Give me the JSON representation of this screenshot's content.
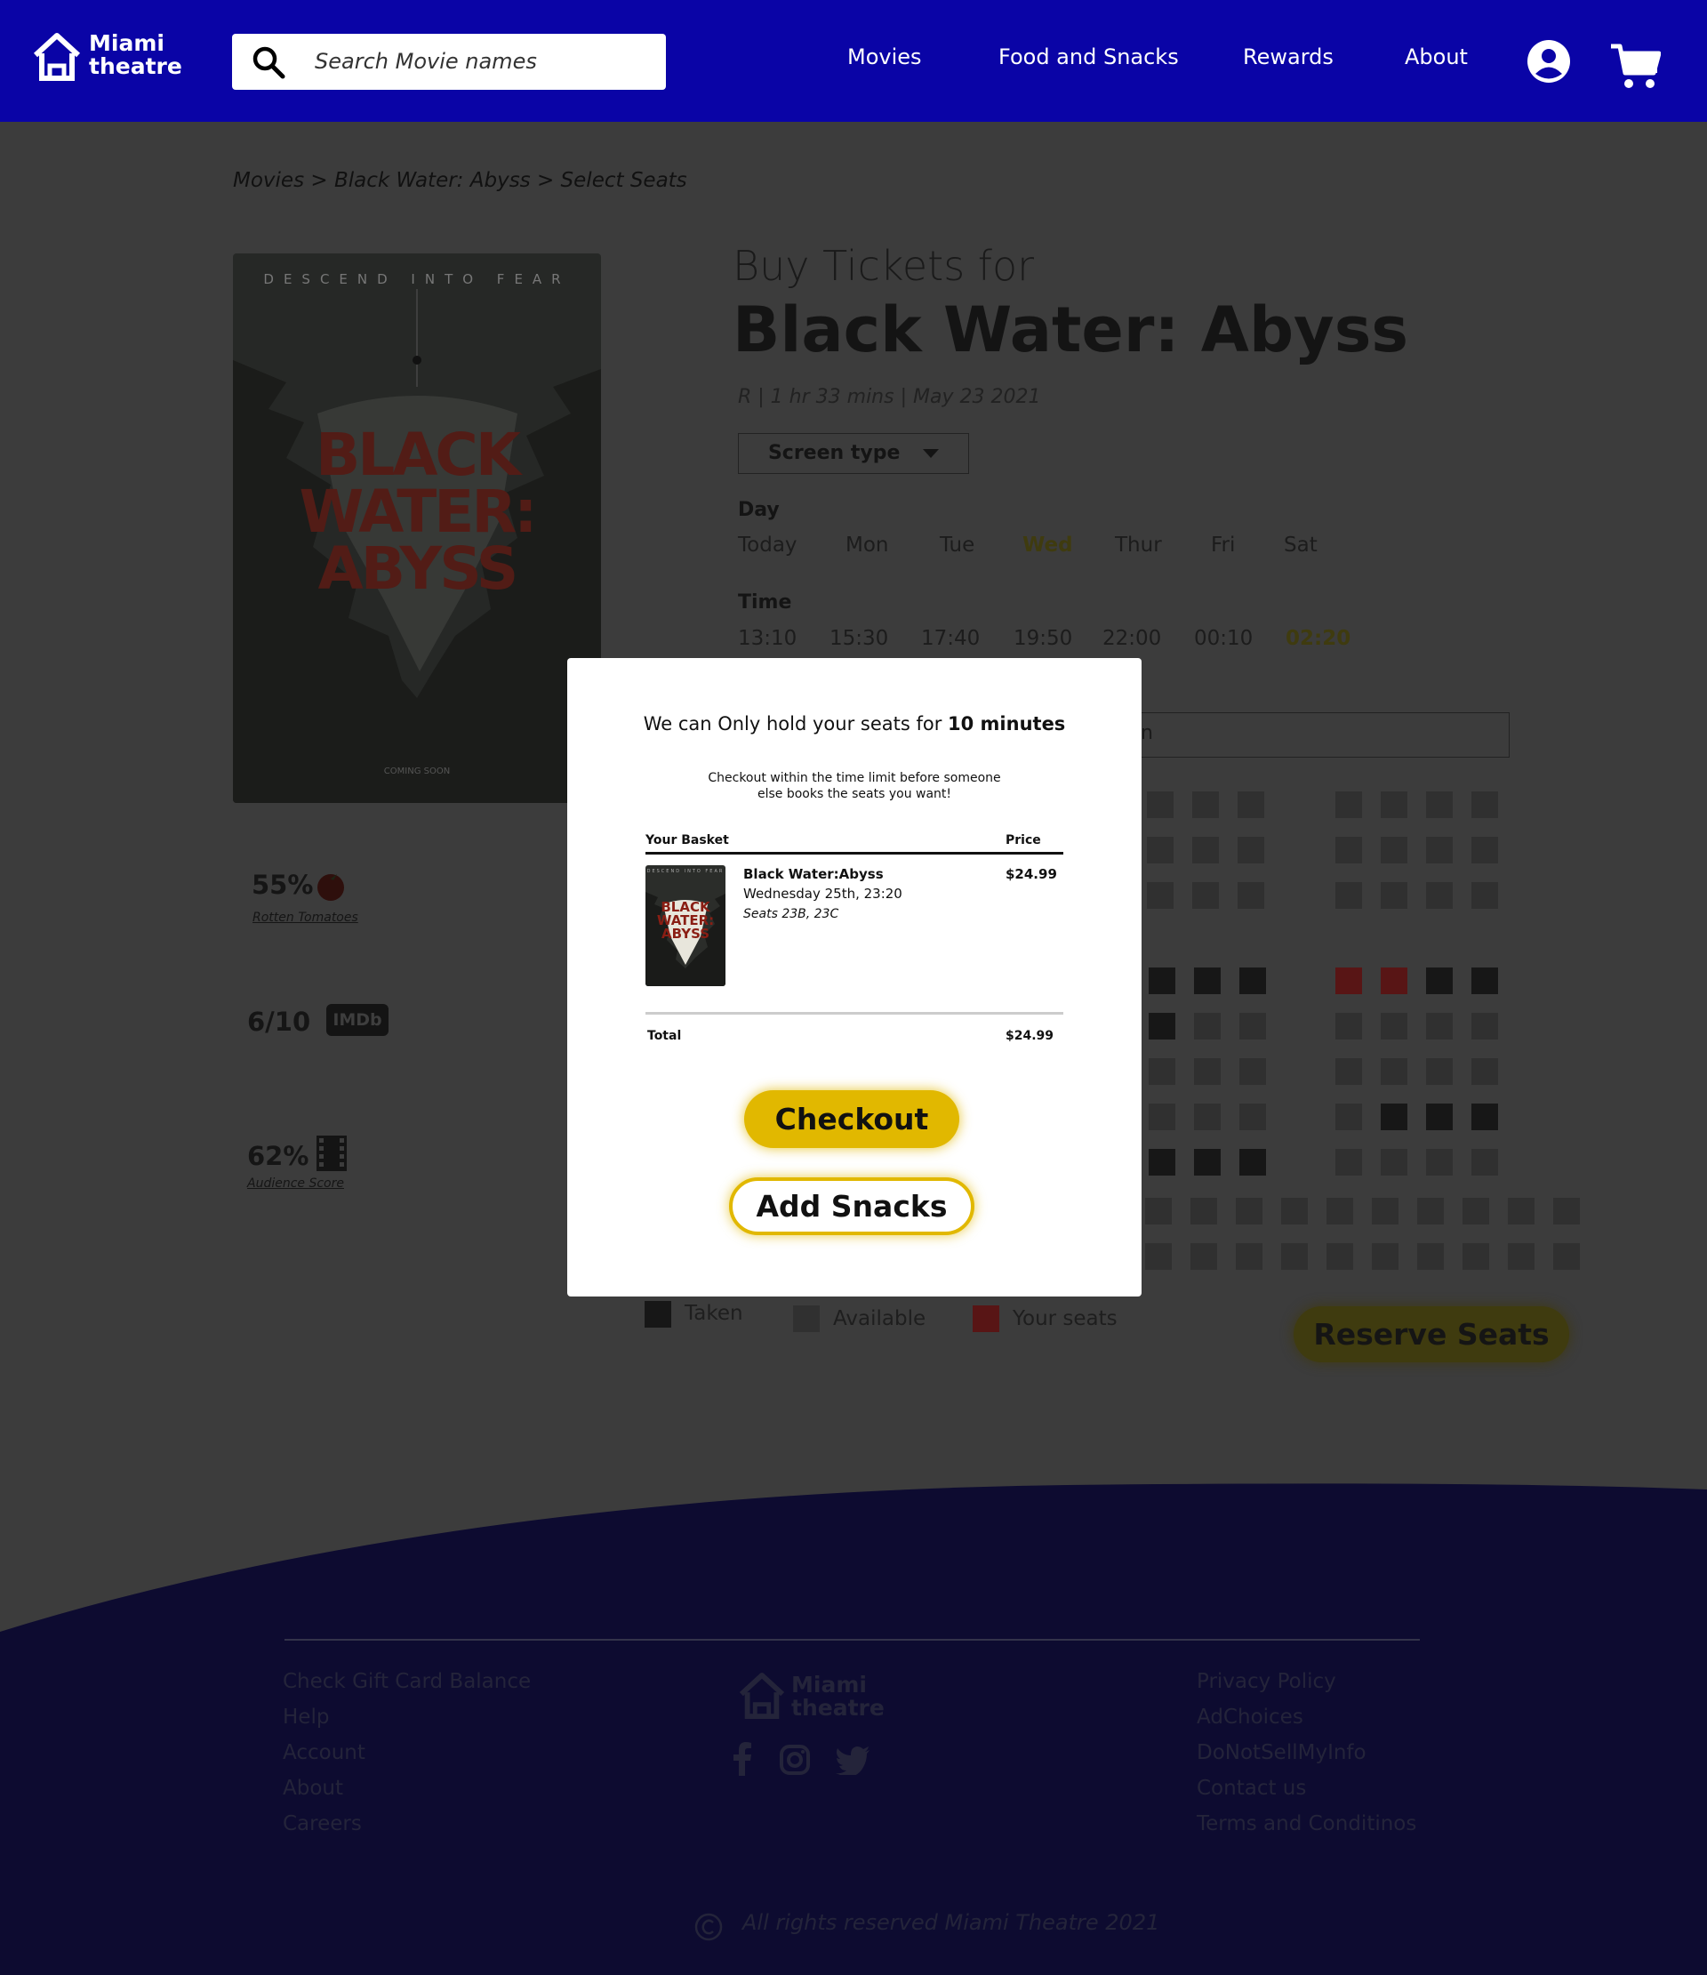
{
  "header": {
    "logo_line1": "Miami",
    "logo_line2": "theatre",
    "search_placeholder": "Search Movie names",
    "nav": [
      "Movies",
      "Food and Snacks",
      "Rewards",
      "About"
    ],
    "icons": [
      "user-icon",
      "cart-icon"
    ]
  },
  "breadcrumb": "Movies > Black Water: Abyss > Select Seats",
  "poster": {
    "tagline": "DESCEND INTO FEAR",
    "title": "BLACK WATER: ABYSS",
    "footer": "COMING SOON"
  },
  "movie": {
    "buy_label": "Buy Tickets for",
    "title": "Black Water: Abyss",
    "meta": "R | 1 hr 33 mins | May 23 2021",
    "screen_type": "Screen type"
  },
  "day": {
    "label": "Day",
    "options": [
      "Today",
      "Mon",
      "Tue",
      "Wed",
      "Thur",
      "Fri",
      "Sat"
    ],
    "selected": "Wed"
  },
  "time": {
    "label": "Time",
    "options": [
      "13:10",
      "15:30",
      "17:40",
      "19:50",
      "22:00",
      "00:10",
      "02:20"
    ],
    "selected": "02:20"
  },
  "theater_box_text": "n",
  "scores": {
    "rotten": {
      "value": "55%",
      "label": "Rotten Tomatoes"
    },
    "imdb": {
      "value": "6/10",
      "badge": "IMDb"
    },
    "audience": {
      "value": "62%",
      "label": "Audience Score"
    }
  },
  "legend": {
    "taken": "Taken",
    "available": "Available",
    "yours": "Your seats"
  },
  "reserve_label": "Reserve Seats",
  "footer": {
    "col1": [
      "Check Gift Card Balance",
      "Help",
      "Account",
      "About",
      "Careers"
    ],
    "col3": [
      "Privacy Policy",
      "AdChoices",
      "DoNotSellMyInfo",
      "Contact us",
      "Terms and Conditinos"
    ],
    "logo_line1": "Miami",
    "logo_line2": "theatre",
    "social": [
      "facebook-icon",
      "instagram-icon",
      "twitter-icon"
    ],
    "copyright": "All rights reserved Miami Theatre 2021"
  },
  "modal": {
    "hold_prefix": "We can Only hold your seats for ",
    "hold_bold": "10 minutes",
    "sub": "Checkout within the time limit before someone else books the seats you want!",
    "basket_label": "Your Basket",
    "price_label": "Price",
    "item": {
      "name": "Black Water:Abyss",
      "date": "Wednesday 25th, 23:20",
      "seats": "Seats 23B, 23C",
      "price": "$24.99",
      "thumb_title": "BLACK WATER: ABYSS",
      "thumb_tagline": "DESCEND INTO FEAR"
    },
    "total_label": "Total",
    "total_value": "$24.99",
    "checkout_label": "Checkout",
    "snacks_label": "Add Snacks"
  },
  "colors": {
    "header_bg": "#0a04a6",
    "accent": "#e1b800",
    "overlay_bg": "#3c3c3c",
    "footer_bg": "#0d0b30",
    "your_seat": "#581515"
  }
}
